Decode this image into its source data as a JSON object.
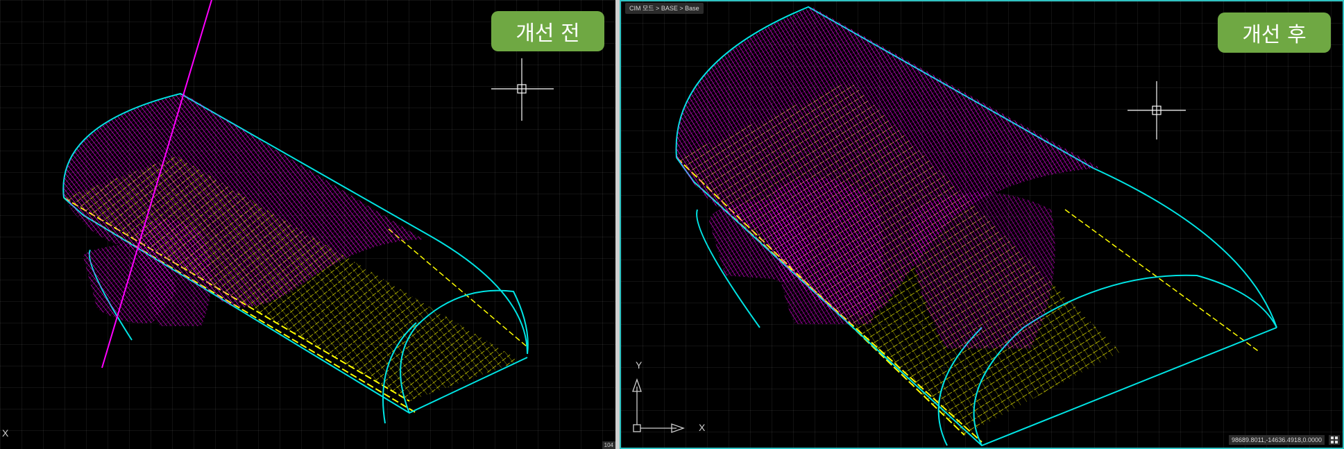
{
  "left_view": {
    "badge": "개선 전",
    "axis_x_label": "X",
    "scale_text": "104",
    "colors": {
      "mesh": "#ff00ff",
      "structure": "#ffff00",
      "outline": "#00e5e5"
    }
  },
  "right_view": {
    "badge": "개선 후",
    "breadcrumb": "CIM 모드 > BASE > Base",
    "coordinates": "98689.8011,-14636.4918,0.0000",
    "axis_x_label": "X",
    "axis_y_label": "Y",
    "border_color": "#2fc4c4",
    "colors": {
      "mesh": "#ff00ff",
      "structure": "#ffff00",
      "outline": "#00e5e5"
    }
  }
}
